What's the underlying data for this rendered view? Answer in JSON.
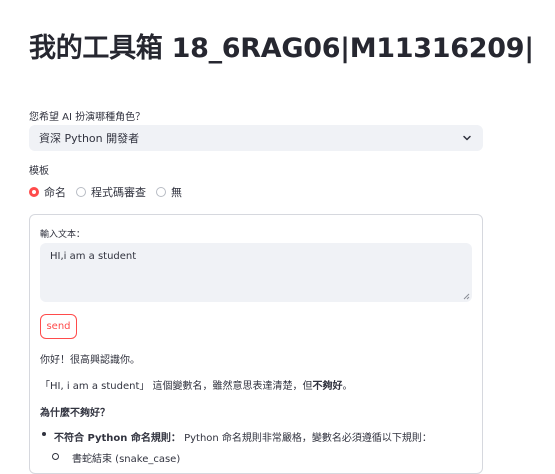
{
  "page": {
    "title": "我的工具箱 18_6RAG06|M11316209|"
  },
  "role_select": {
    "label": "您希望 AI 扮演哪種角色？",
    "value": "資深 Python 開發者",
    "icon": "chevron-down-icon"
  },
  "template": {
    "label": "模板",
    "options": [
      "命名",
      "程式碼審查",
      "無"
    ],
    "selected": "命名",
    "accent": "#ff4b4b"
  },
  "form": {
    "input_label": "輸入文本：",
    "input_value": "HI,i am a student",
    "send_label": "send"
  },
  "response": {
    "greeting": "你好！很高興認識你。",
    "line1_pre": "「HI, i am a student」 這個變數名，雖然意思表達清楚，但",
    "line1_bold": "不夠好",
    "line1_post": "。",
    "heading": "為什麼不夠好？",
    "bullet1_bold": "不符合 Python 命名規則：",
    "bullet1_text": " Python 命名規則非常嚴格，變數名必須遵循以下規則：",
    "sub1": "書蛇結束 (snake_case)"
  }
}
